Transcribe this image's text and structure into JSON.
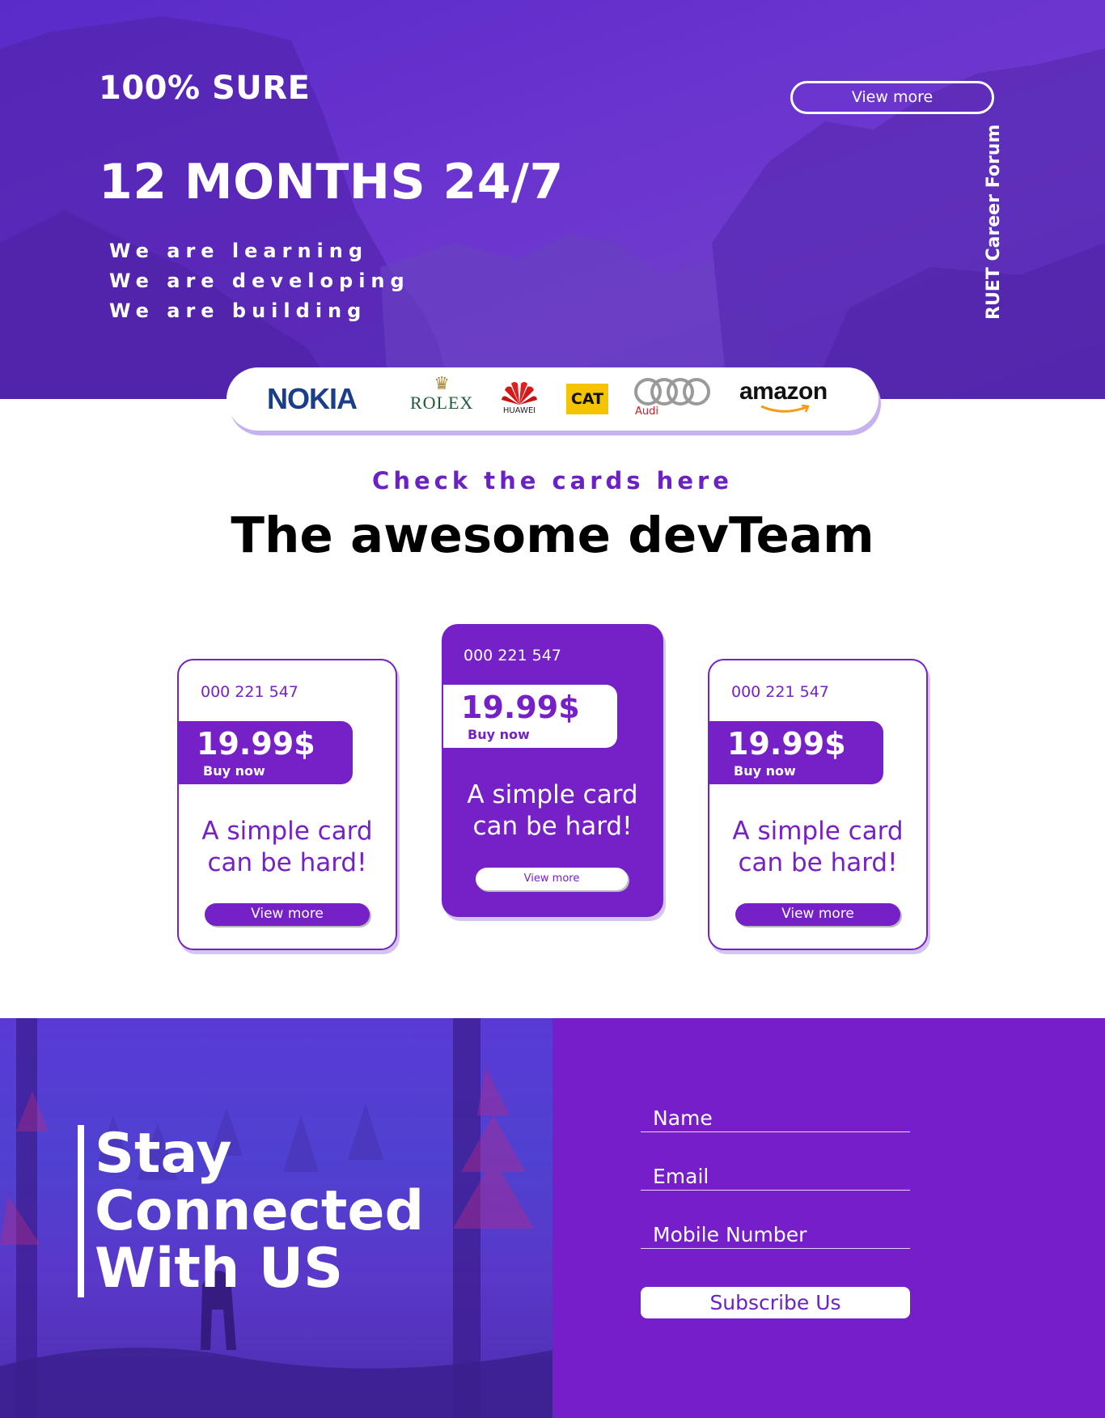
{
  "hero": {
    "tagline": "100% SURE",
    "headline": "12 MONTHS 24/7",
    "lines": [
      "We are learning",
      "We are developing",
      "We are building"
    ],
    "view_more_label": "View more",
    "vertical_text": "RUET Career Forum"
  },
  "logos": {
    "nokia": "NOKIA",
    "rolex": "ROLEX",
    "huawei": "HUAWEI",
    "cat": "CAT",
    "audi": "Audi",
    "amazon": "amazon"
  },
  "section": {
    "subtitle": "Check the cards here",
    "title": "The awesome devTeam"
  },
  "cards": [
    {
      "code": "000 221 547",
      "price": "19.99$",
      "buy": "Buy now",
      "text_line1": "A simple card",
      "text_line2": "can be hard!",
      "button": "View more"
    },
    {
      "code": "000 221 547",
      "price": "19.99$",
      "buy": "Buy now",
      "text_line1": "A simple card",
      "text_line2": "can be hard!",
      "button": "View more"
    },
    {
      "code": "000 221 547",
      "price": "19.99$",
      "buy": "Buy now",
      "text_line1": "A simple card",
      "text_line2": "can be hard!",
      "button": "View more"
    }
  ],
  "subscribe": {
    "title_lines": [
      "Stay",
      "Connected",
      "With US"
    ],
    "name_placeholder": "Name",
    "email_placeholder": "Email",
    "mobile_placeholder": "Mobile Number",
    "button": "Subscribe Us"
  },
  "colors": {
    "accent": "#7620c8",
    "hero_bg": "#6a34cf",
    "white": "#ffffff"
  },
  "icons": [
    "rolex-crown-icon",
    "huawei-petals-icon",
    "audi-rings-icon",
    "amazon-smile-icon"
  ]
}
